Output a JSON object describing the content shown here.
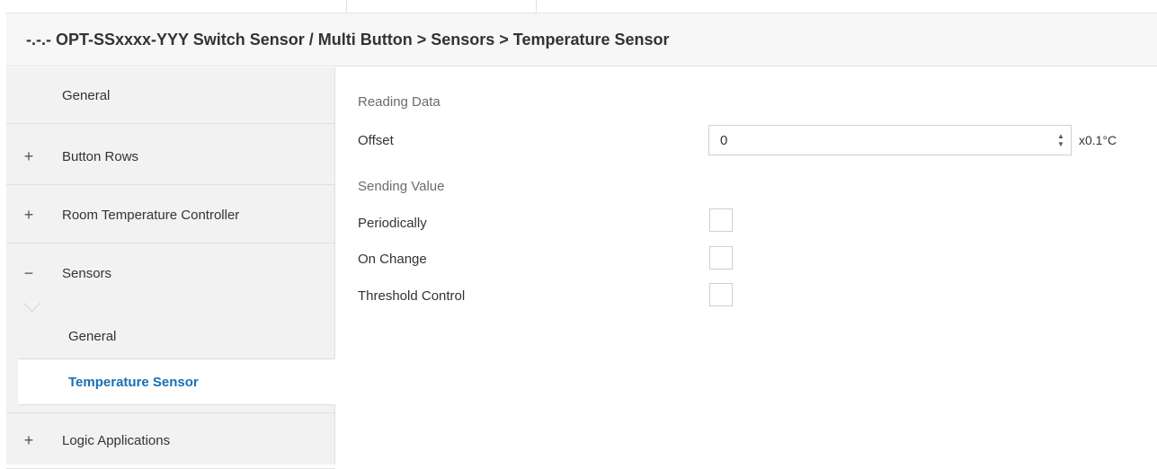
{
  "header": {
    "breadcrumb": "-.-.- OPT-SSxxxx-YYY Switch Sensor / Multi Button > Sensors > Temperature Sensor"
  },
  "sidebar": {
    "items": [
      {
        "sign": "",
        "label": "General"
      },
      {
        "sign": "+",
        "label": "Button Rows"
      },
      {
        "sign": "+",
        "label": "Room Temperature Controller"
      },
      {
        "sign": "−",
        "label": "Sensors"
      },
      {
        "sign": "+",
        "label": "Logic Applications"
      }
    ],
    "sub_items": [
      {
        "label": "General"
      },
      {
        "label": "Temperature Sensor",
        "active": true
      }
    ]
  },
  "content": {
    "reading_data_title": "Reading Data",
    "offset": {
      "label": "Offset",
      "value": "0",
      "unit": "x0.1°C"
    },
    "sending_value_title": "Sending Value",
    "periodically": {
      "label": "Periodically",
      "checked": false
    },
    "on_change": {
      "label": "On Change",
      "checked": false
    },
    "threshold_control": {
      "label": "Threshold Control",
      "checked": false
    }
  },
  "colors": {
    "active_text": "#1a6fb3",
    "sidebar_bg": "#f2f2f2",
    "header_bg": "#f7f7f7"
  }
}
